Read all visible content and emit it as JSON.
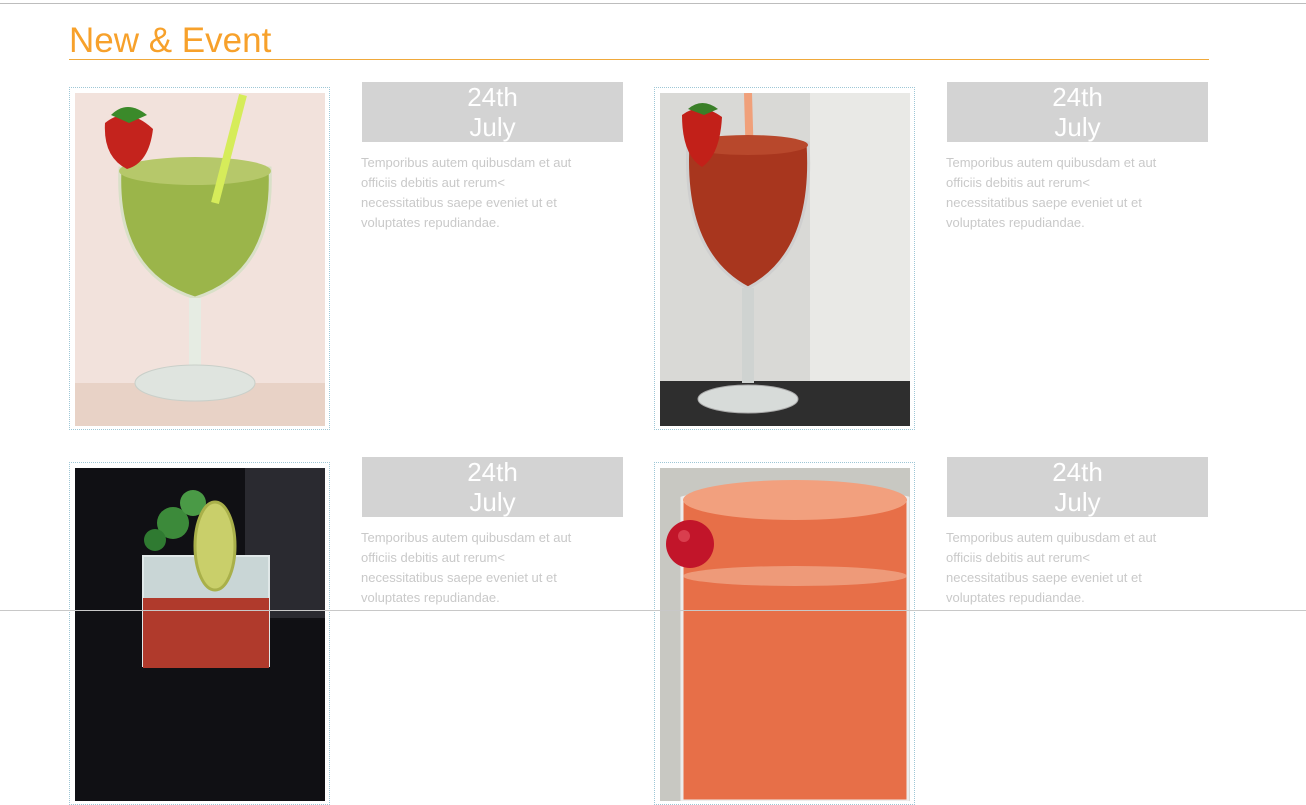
{
  "section": {
    "title": "New & Event"
  },
  "events": [
    {
      "day": "24th",
      "month": "July",
      "text": "Temporibus autem quibusdam et aut officiis debitis aut rerum< necessitatibus saepe eveniet ut et voluptates repudiandae.",
      "image": "kiwi-smoothie-photo"
    },
    {
      "day": "24th",
      "month": "July",
      "text": "Temporibus autem quibusdam et aut officiis debitis aut rerum< necessitatibus saepe eveniet ut et voluptates repudiandae.",
      "image": "strawberry-smoothie-photo"
    },
    {
      "day": "24th",
      "month": "July",
      "text": "Temporibus autem quibusdam et aut officiis debitis aut rerum< necessitatibus saepe eveniet ut et voluptates repudiandae.",
      "image": "mojito-photo"
    },
    {
      "day": "24th",
      "month": "July",
      "text": "Temporibus autem quibusdam et aut officiis debitis aut rerum< necessitatibus saepe eveniet ut et voluptates repudiandae.",
      "image": "orange-smoothie-photo"
    }
  ],
  "colors": {
    "accent": "#f7a12b",
    "badge": "#d3d3d3",
    "text_muted": "#c9c9c9"
  }
}
